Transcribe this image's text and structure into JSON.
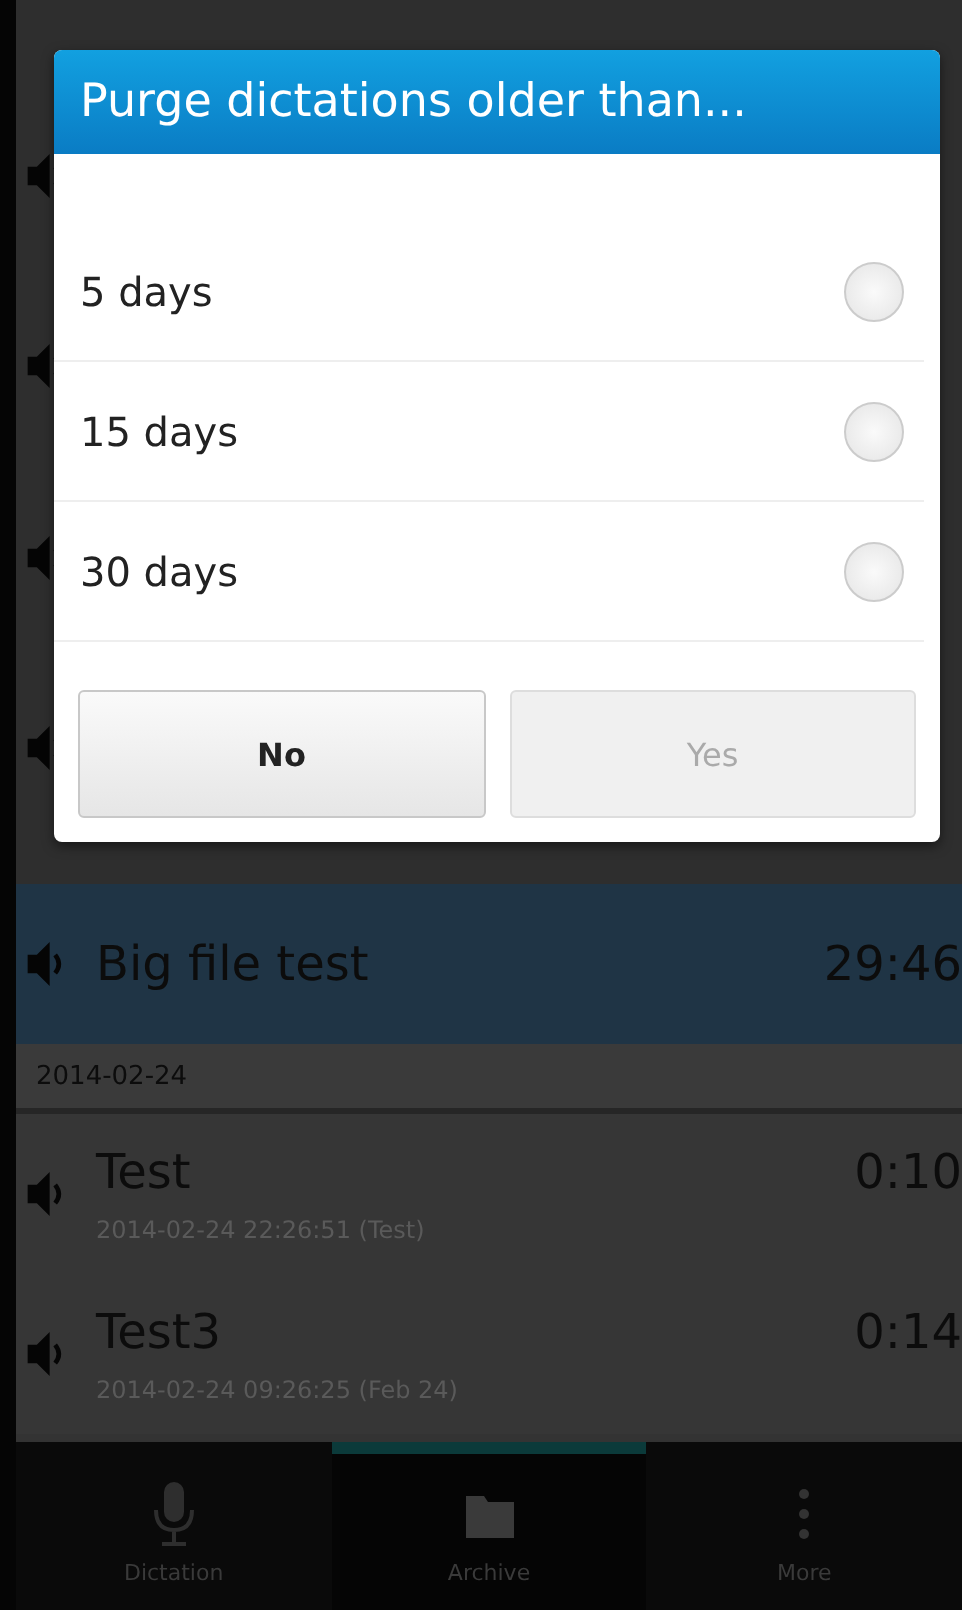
{
  "dialog": {
    "title": "Purge dictations older than...",
    "options": [
      {
        "label": "5 days",
        "selected": false
      },
      {
        "label": "15 days",
        "selected": false
      },
      {
        "label": "30 days",
        "selected": false
      }
    ],
    "buttons": [
      {
        "label": "No",
        "disabled": false
      },
      {
        "label": "Yes",
        "disabled": true
      }
    ]
  },
  "list": {
    "items": [
      {
        "kind": "row",
        "title": "Big file test",
        "duration": "29:46",
        "selected": true
      },
      {
        "kind": "header",
        "date": "2014-02-24"
      },
      {
        "kind": "row",
        "title": "Test",
        "duration": "0:10",
        "subtitle": "2014-02-24 22:26:51 (Test)",
        "selected": false
      },
      {
        "kind": "row",
        "title": "Test3",
        "duration": "0:14",
        "subtitle": "2014-02-24 09:26:25 (Feb 24)",
        "selected": false
      }
    ]
  },
  "tab_bar": {
    "tabs": [
      {
        "label": "Dictation",
        "selected": false
      },
      {
        "label": "Archive",
        "selected": true
      },
      {
        "label": "More",
        "selected": false
      }
    ]
  }
}
